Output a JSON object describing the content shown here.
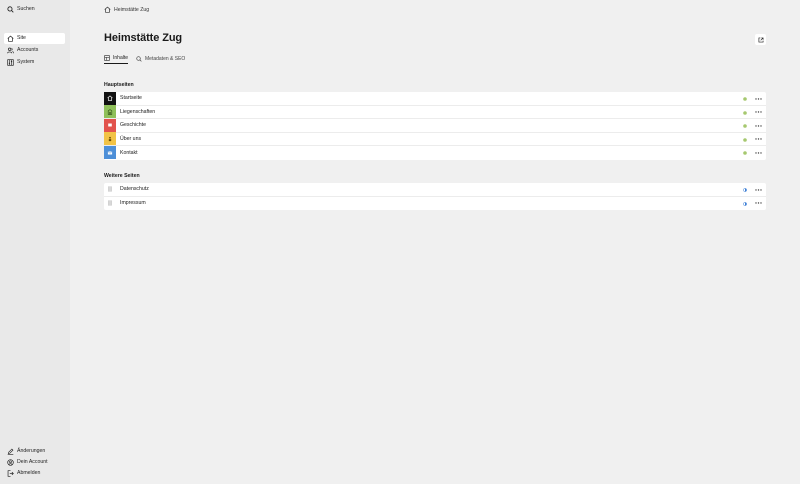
{
  "sidebar": {
    "search_label": "Suchen",
    "menu": [
      {
        "label": "Site",
        "icon": "home-icon",
        "active": true
      },
      {
        "label": "Accounts",
        "icon": "users-icon",
        "active": false
      },
      {
        "label": "System",
        "icon": "system-icon",
        "active": false
      }
    ],
    "footer": [
      {
        "label": "Änderungen",
        "icon": "edit-icon"
      },
      {
        "label": "Dein Account",
        "icon": "account-icon"
      },
      {
        "label": "Abmelden",
        "icon": "logout-icon"
      }
    ]
  },
  "breadcrumb": {
    "label": "Heimstätte Zug",
    "icon": "home-icon"
  },
  "page": {
    "title": "Heimstätte Zug"
  },
  "tabs": [
    {
      "label": "Inhalte",
      "icon": "content-icon",
      "active": true
    },
    {
      "label": "Metadaten & SEO",
      "icon": "search-icon",
      "active": false
    }
  ],
  "sections": {
    "main": {
      "label": "Hauptseiten",
      "pages": [
        {
          "title": "Startseite",
          "color": "#111111",
          "icon": "home-icon",
          "status": "published"
        },
        {
          "title": "Liegenschaften",
          "color": "#8fc05a",
          "icon": "building-icon",
          "status": "published"
        },
        {
          "title": "Geschichte",
          "color": "#e2534d",
          "icon": "book-icon",
          "status": "published"
        },
        {
          "title": "Über uns",
          "color": "#f2c346",
          "icon": "people-icon",
          "status": "published"
        },
        {
          "title": "Kontakt",
          "color": "#4d8fd8",
          "icon": "mail-icon",
          "status": "published"
        }
      ]
    },
    "other": {
      "label": "Weitere Seiten",
      "pages": [
        {
          "title": "Datenschutz",
          "icon": "page-icon",
          "status": "unlisted"
        },
        {
          "title": "Impressum",
          "icon": "page-icon",
          "status": "unlisted"
        }
      ]
    }
  },
  "colors": {
    "published": "#a6c86f",
    "unlisted": "#3d7fd6",
    "sidebar_bg": "#e9e9e9",
    "main_bg": "#f0f0f0"
  }
}
